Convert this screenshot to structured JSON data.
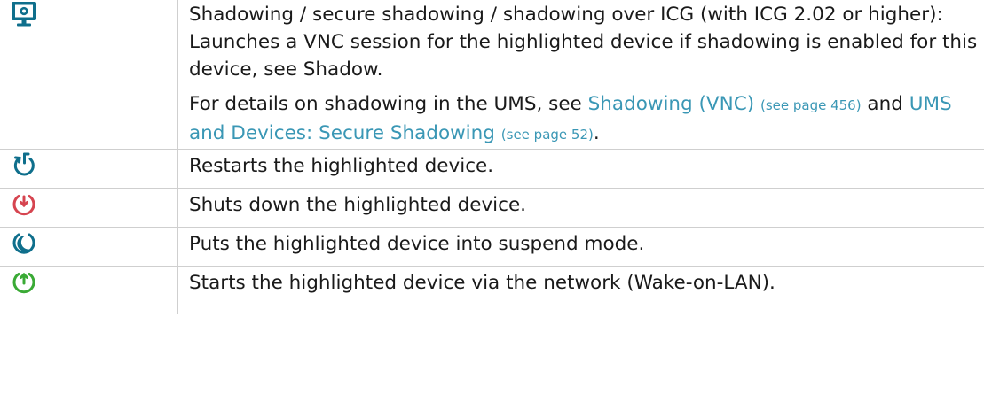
{
  "rows": [
    {
      "icon": "monitor-shadowing-icon",
      "description_p1": "Shadowing / secure shadowing / shadowing over ICG (with ICG 2.02 or higher): Launches a VNC session for the highlighted device if shadowing is enabled for this device, see Shadow.",
      "details_prefix": "For details on shadowing in the UMS, see ",
      "link1_text": "Shadowing (VNC)",
      "link1_ref": "(see page 456)",
      "details_and": " and ",
      "link2_text": "UMS and Devices: Secure Shadowing",
      "link2_ref": "(see page 52)",
      "details_end": "."
    },
    {
      "icon": "restart-icon",
      "description": "Restarts the highlighted device."
    },
    {
      "icon": "shutdown-icon",
      "description": "Shuts down the highlighted device."
    },
    {
      "icon": "suspend-icon",
      "description": "Puts the highlighted device into suspend mode."
    },
    {
      "icon": "wake-on-lan-icon",
      "description": "Starts the highlighted device via the network (Wake-on-LAN)."
    }
  ],
  "colors": {
    "link": "#3a97b5",
    "monitor_icon": "#0f6f8c",
    "restart_icon": "#0f6f8c",
    "shutdown_icon": "#d64550",
    "suspend_icon": "#0f6f8c",
    "wake_icon": "#3aaa35",
    "grid": "#cfcfcf"
  }
}
